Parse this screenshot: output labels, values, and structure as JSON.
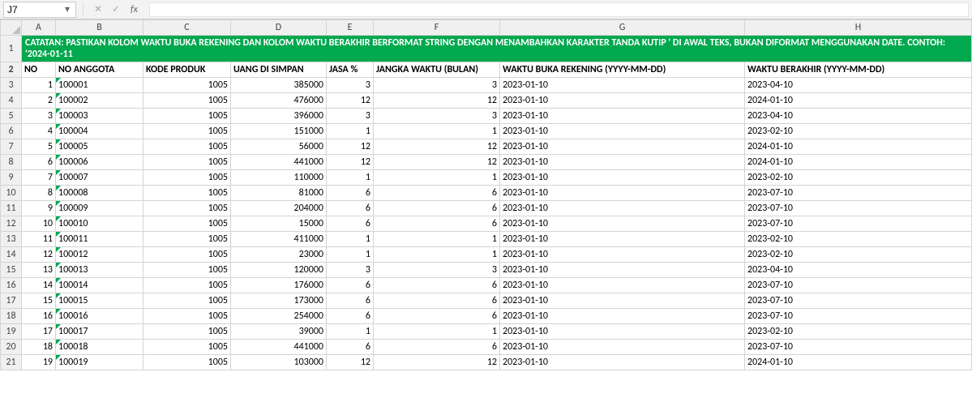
{
  "namebox": {
    "value": "J7"
  },
  "formula_bar": {
    "value": "",
    "fx_label": "fx"
  },
  "columns": [
    "A",
    "B",
    "C",
    "D",
    "E",
    "F",
    "G",
    "H"
  ],
  "row_numbers": [
    1,
    2,
    3,
    4,
    5,
    6,
    7,
    8,
    9,
    10,
    11,
    12,
    13,
    14,
    15,
    16,
    17,
    18,
    19,
    20,
    21
  ],
  "note_text": "CATATAN: PASTIKAN KOLOM WAKTU BUKA REKENING DAN KOLOM WAKTU BERAKHIR BERFORMAT STRING DENGAN MENAMBAHKAN KARAKTER TANDA KUTIP ' DI AWAL TEKS, BUKAN DIFORMAT MENGGUNAKAN DATE. CONTOH: '2024-01-11",
  "headers": {
    "a": "NO",
    "b": "NO ANGGOTA",
    "c": "KODE PRODUK",
    "d": "UANG DI SIMPAN",
    "e": "JASA %",
    "f": "JANGKA WAKTU (BULAN)",
    "g": "WAKTU BUKA REKENING (YYYY-MM-DD)",
    "h": "WAKTU BERAKHIR (YYYY-MM-DD)"
  },
  "rows": [
    {
      "no": 1,
      "anggota": "100001",
      "produk": 1005,
      "simpan": 385000,
      "jasa": 3,
      "bulan": 3,
      "buka": "2023-01-10",
      "akhir": "2023-04-10"
    },
    {
      "no": 2,
      "anggota": "100002",
      "produk": 1005,
      "simpan": 476000,
      "jasa": 12,
      "bulan": 12,
      "buka": "2023-01-10",
      "akhir": "2024-01-10"
    },
    {
      "no": 3,
      "anggota": "100003",
      "produk": 1005,
      "simpan": 396000,
      "jasa": 3,
      "bulan": 3,
      "buka": "2023-01-10",
      "akhir": "2023-04-10"
    },
    {
      "no": 4,
      "anggota": "100004",
      "produk": 1005,
      "simpan": 151000,
      "jasa": 1,
      "bulan": 1,
      "buka": "2023-01-10",
      "akhir": "2023-02-10"
    },
    {
      "no": 5,
      "anggota": "100005",
      "produk": 1005,
      "simpan": 56000,
      "jasa": 12,
      "bulan": 12,
      "buka": "2023-01-10",
      "akhir": "2024-01-10"
    },
    {
      "no": 6,
      "anggota": "100006",
      "produk": 1005,
      "simpan": 441000,
      "jasa": 12,
      "bulan": 12,
      "buka": "2023-01-10",
      "akhir": "2024-01-10"
    },
    {
      "no": 7,
      "anggota": "100007",
      "produk": 1005,
      "simpan": 110000,
      "jasa": 1,
      "bulan": 1,
      "buka": "2023-01-10",
      "akhir": "2023-02-10"
    },
    {
      "no": 8,
      "anggota": "100008",
      "produk": 1005,
      "simpan": 81000,
      "jasa": 6,
      "bulan": 6,
      "buka": "2023-01-10",
      "akhir": "2023-07-10"
    },
    {
      "no": 9,
      "anggota": "100009",
      "produk": 1005,
      "simpan": 204000,
      "jasa": 6,
      "bulan": 6,
      "buka": "2023-01-10",
      "akhir": "2023-07-10"
    },
    {
      "no": 10,
      "anggota": "100010",
      "produk": 1005,
      "simpan": 15000,
      "jasa": 6,
      "bulan": 6,
      "buka": "2023-01-10",
      "akhir": "2023-07-10"
    },
    {
      "no": 11,
      "anggota": "100011",
      "produk": 1005,
      "simpan": 411000,
      "jasa": 1,
      "bulan": 1,
      "buka": "2023-01-10",
      "akhir": "2023-02-10"
    },
    {
      "no": 12,
      "anggota": "100012",
      "produk": 1005,
      "simpan": 23000,
      "jasa": 1,
      "bulan": 1,
      "buka": "2023-01-10",
      "akhir": "2023-02-10"
    },
    {
      "no": 13,
      "anggota": "100013",
      "produk": 1005,
      "simpan": 120000,
      "jasa": 3,
      "bulan": 3,
      "buka": "2023-01-10",
      "akhir": "2023-04-10"
    },
    {
      "no": 14,
      "anggota": "100014",
      "produk": 1005,
      "simpan": 176000,
      "jasa": 6,
      "bulan": 6,
      "buka": "2023-01-10",
      "akhir": "2023-07-10"
    },
    {
      "no": 15,
      "anggota": "100015",
      "produk": 1005,
      "simpan": 173000,
      "jasa": 6,
      "bulan": 6,
      "buka": "2023-01-10",
      "akhir": "2023-07-10"
    },
    {
      "no": 16,
      "anggota": "100016",
      "produk": 1005,
      "simpan": 254000,
      "jasa": 6,
      "bulan": 6,
      "buka": "2023-01-10",
      "akhir": "2023-07-10"
    },
    {
      "no": 17,
      "anggota": "100017",
      "produk": 1005,
      "simpan": 39000,
      "jasa": 1,
      "bulan": 1,
      "buka": "2023-01-10",
      "akhir": "2023-02-10"
    },
    {
      "no": 18,
      "anggota": "100018",
      "produk": 1005,
      "simpan": 441000,
      "jasa": 6,
      "bulan": 6,
      "buka": "2023-01-10",
      "akhir": "2023-07-10"
    },
    {
      "no": 19,
      "anggota": "100019",
      "produk": 1005,
      "simpan": 103000,
      "jasa": 12,
      "bulan": 12,
      "buka": "2023-01-10",
      "akhir": "2024-01-10"
    }
  ],
  "selected_cell": "J7"
}
